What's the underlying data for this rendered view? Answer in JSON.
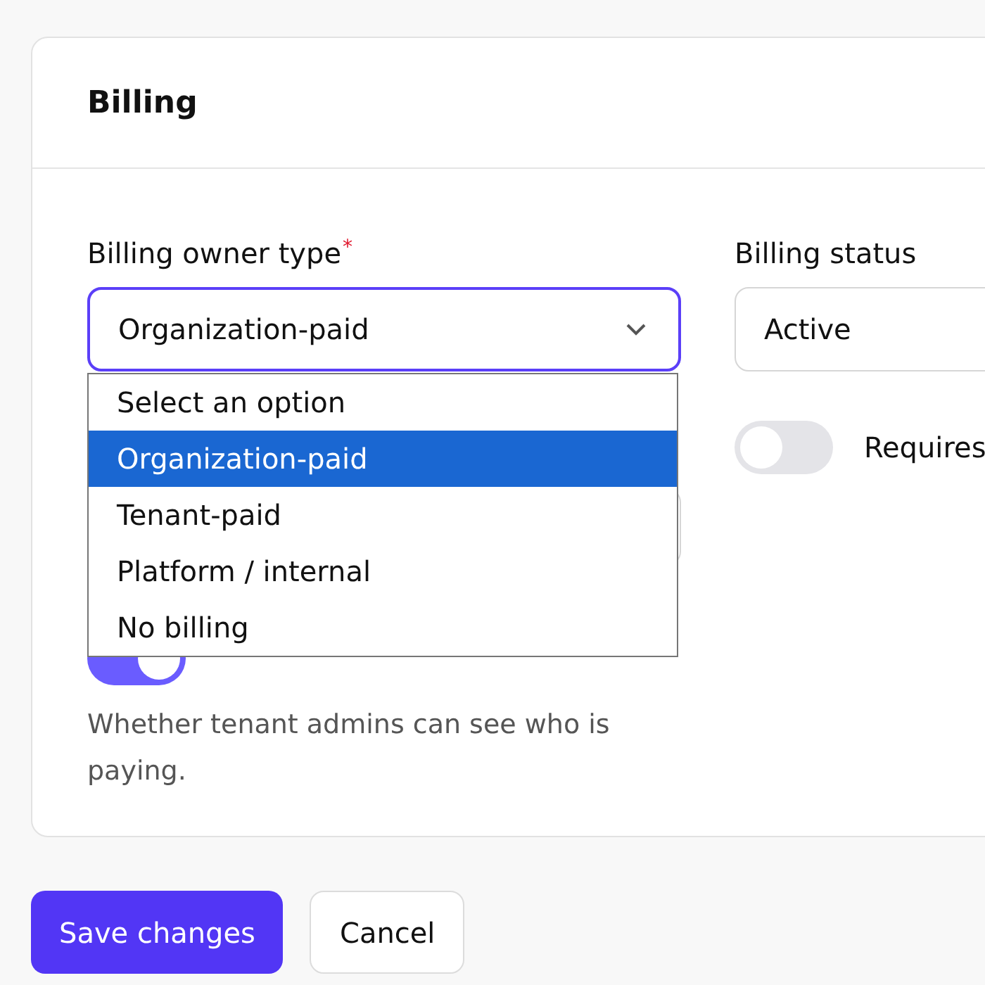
{
  "card": {
    "title": "Billing"
  },
  "owner_type": {
    "label": "Billing owner type",
    "required_mark": "*",
    "value": "Organization-paid",
    "expanded": true,
    "options": [
      {
        "label": "Select an option",
        "selected": false
      },
      {
        "label": "Organization-paid",
        "selected": true
      },
      {
        "label": "Tenant-paid",
        "selected": false
      },
      {
        "label": "Platform / internal",
        "selected": false
      },
      {
        "label": "No billing",
        "selected": false
      }
    ]
  },
  "visibility_toggle": {
    "on": true,
    "help": "Whether tenant admins can see who is paying."
  },
  "billing_status": {
    "label": "Billing status",
    "value": "Active"
  },
  "requires_toggle": {
    "label": "Requires",
    "on": false
  },
  "buttons": [
    {
      "label": "Save changes",
      "kind": "primary"
    },
    {
      "label": "Cancel",
      "kind": "secondary"
    }
  ]
}
